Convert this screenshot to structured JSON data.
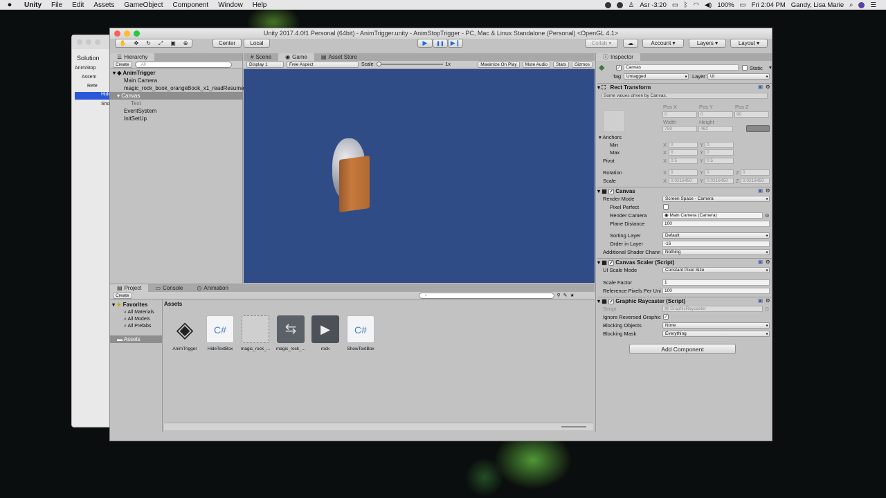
{
  "menubar": {
    "apple": "",
    "items": [
      "Unity",
      "File",
      "Edit",
      "Assets",
      "GameObject",
      "Component",
      "Window",
      "Help"
    ],
    "status": {
      "prayer": "Asr -3:20",
      "battery": "100%",
      "clock": "Fri 2:04 PM",
      "user": "Gandy, Lisa Marie"
    }
  },
  "vs": {
    "solution": "Solution",
    "rows": [
      "AnimStop",
      "Assem",
      "Refe",
      "Hide",
      "Show"
    ]
  },
  "unity": {
    "title": "Unity 2017.4.0f1 Personal (64bit) - AnimTrigger.unity - AnimStopTrigger - PC, Mac & Linux Standalone (Personal) <OpenGL 4.1>",
    "toolbar": {
      "pivot": "Center",
      "space": "Local",
      "play": "▶",
      "pause": "❚❚",
      "step": "▶❙",
      "collab": "Collab ▾",
      "account": "Account",
      "layers": "Layers",
      "layout": "Layout"
    },
    "hierarchy": {
      "tab": "Hierarchy",
      "create": "Create",
      "search": "All",
      "scene": "AnimTrigger",
      "items": [
        {
          "label": "Main Camera",
          "indent": 1
        },
        {
          "label": "magic_rock_book_orangeBook_x1_readResume",
          "indent": 1
        },
        {
          "label": "Canvas",
          "indent": 1,
          "selected": true
        },
        {
          "label": "Text",
          "indent": 2
        },
        {
          "label": "EventSystem",
          "indent": 1
        },
        {
          "label": "InitSetUp",
          "indent": 1
        }
      ]
    },
    "game": {
      "tabs": [
        "Scene",
        "Game",
        "Asset Store"
      ],
      "display": "Display 1",
      "aspect": "Free Aspect",
      "scale_label": "Scale",
      "scale_value": "1x",
      "maximize": "Maximize On Play",
      "mute": "Mute Audio",
      "stats": "Stats",
      "gizmos": "Gizmos",
      "bg_color": "#2f4c86"
    },
    "project": {
      "tabs": [
        "Project",
        "Console",
        "Animation"
      ],
      "create": "Create",
      "favorites": "Favorites",
      "fav_items": [
        "All Materials",
        "All Models",
        "All Prefabs"
      ],
      "assets_root": "Assets",
      "breadcrumb": "Assets",
      "assets": [
        {
          "name": "AnimTrigger",
          "icon": "unity-scene-icon"
        },
        {
          "name": "HideTextBox",
          "icon": "csharp-script-icon"
        },
        {
          "name": "magic_rock_...",
          "icon": "model-icon"
        },
        {
          "name": "magic_rock_...",
          "icon": "prefab-icon"
        },
        {
          "name": "rock",
          "icon": "audio-icon"
        },
        {
          "name": "ShowTextBox",
          "icon": "csharp-script-icon"
        }
      ]
    },
    "inspector": {
      "tab": "Inspector",
      "object_name": "Canvas",
      "static": "Static",
      "tag_label": "Tag",
      "tag": "Untagged",
      "layer_label": "Layer",
      "layer": "UI",
      "rect": {
        "title": "Rect Transform",
        "note": "Some values driven by Canvas.",
        "posx_l": "Pos X",
        "posy_l": "Pos Y",
        "posz_l": "Pos Z",
        "posx": "0",
        "posy": "0",
        "posz": "90",
        "width_l": "Width",
        "height_l": "Height",
        "width": "759",
        "height": "462",
        "anchors": "Anchors",
        "min": "Min",
        "max": "Max",
        "min_x": "0",
        "min_y": "0",
        "max_x": "0",
        "max_y": "0",
        "pivot": "Pivot",
        "pivot_x": "0.5",
        "pivot_y": "0.5",
        "rotation": "Rotation",
        "rot_x": "0",
        "rot_y": "0",
        "rot_z": "0",
        "scale": "Scale",
        "sc_x": "0.0216450",
        "sc_y": "0.0216450",
        "sc_z": "0.0216450",
        "x": "X",
        "y": "Y",
        "z": "Z"
      },
      "canvas": {
        "title": "Canvas",
        "render_mode_l": "Render Mode",
        "render_mode": "Screen Space - Camera",
        "pixel_perfect_l": "Pixel Perfect",
        "render_camera_l": "Render Camera",
        "render_camera": "Main Camera (Camera)",
        "plane_distance_l": "Plane Distance",
        "plane_distance": "100",
        "sorting_layer_l": "Sorting Layer",
        "sorting_layer": "Default",
        "order_l": "Order in Layer",
        "order": "-16",
        "shader_l": "Additional Shader Chann",
        "shader": "Nothing"
      },
      "scaler": {
        "title": "Canvas Scaler (Script)",
        "mode_l": "UI Scale Mode",
        "mode": "Constant Pixel Size",
        "factor_l": "Scale Factor",
        "factor": "1",
        "ref_l": "Reference Pixels Per Uni",
        "ref": "100"
      },
      "raycaster": {
        "title": "Graphic Raycaster (Script)",
        "script_l": "Script",
        "script": "GraphicRaycaster",
        "ignore_l": "Ignore Reversed Graphic",
        "blocking_l": "Blocking Objects",
        "blocking": "None",
        "mask_l": "Blocking Mask",
        "mask": "Everything"
      },
      "add_component": "Add Component"
    }
  }
}
